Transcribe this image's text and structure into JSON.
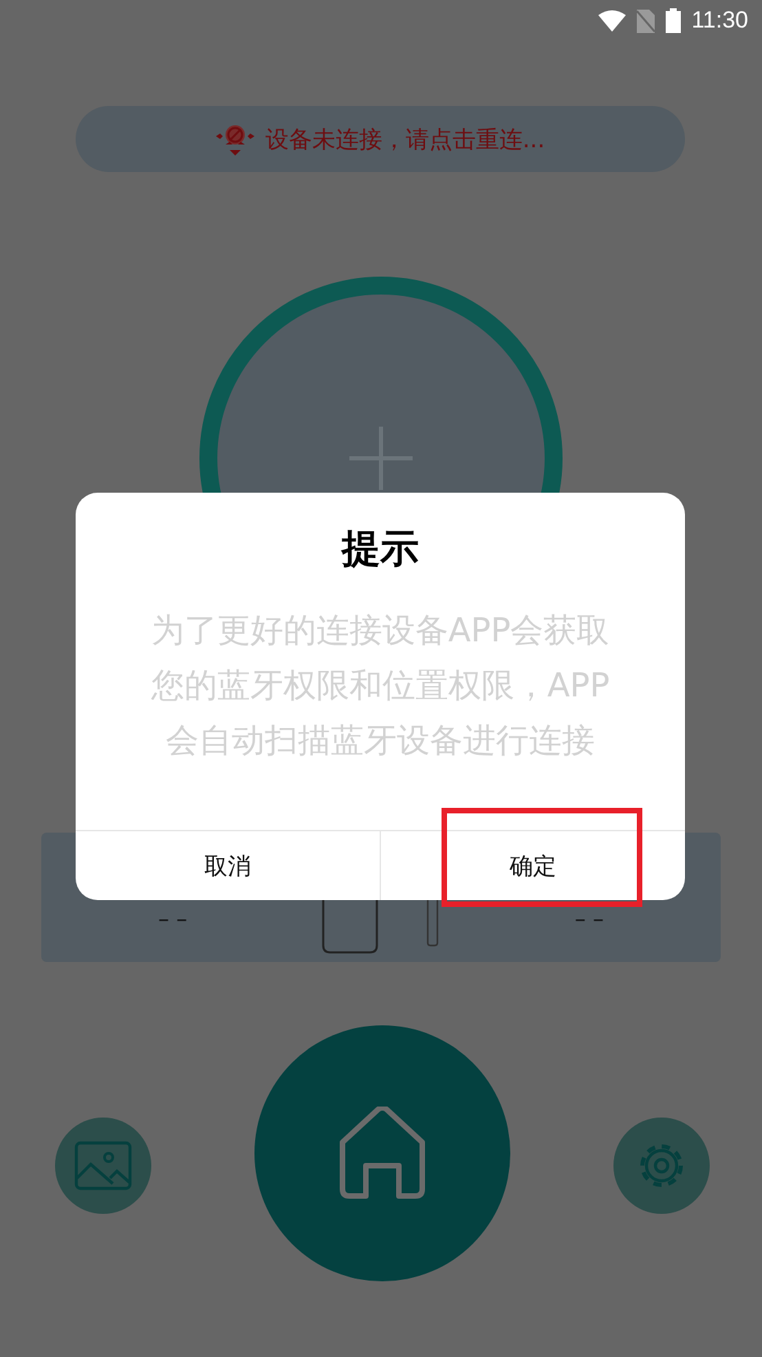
{
  "status_bar": {
    "time": "11:30"
  },
  "connection_banner": {
    "text": "设备未连接，请点击重连..."
  },
  "device_card": {
    "left_value": "– –",
    "right_value": "– –"
  },
  "dialog": {
    "title": "提示",
    "message": "为了更好的连接设备APP会获取您的蓝牙权限和位置权限，APP会自动扫描蓝牙设备进行连接",
    "buttons": [
      {
        "label": "取消",
        "highlighted": false
      },
      {
        "label": "确定",
        "highlighted": true
      }
    ]
  }
}
